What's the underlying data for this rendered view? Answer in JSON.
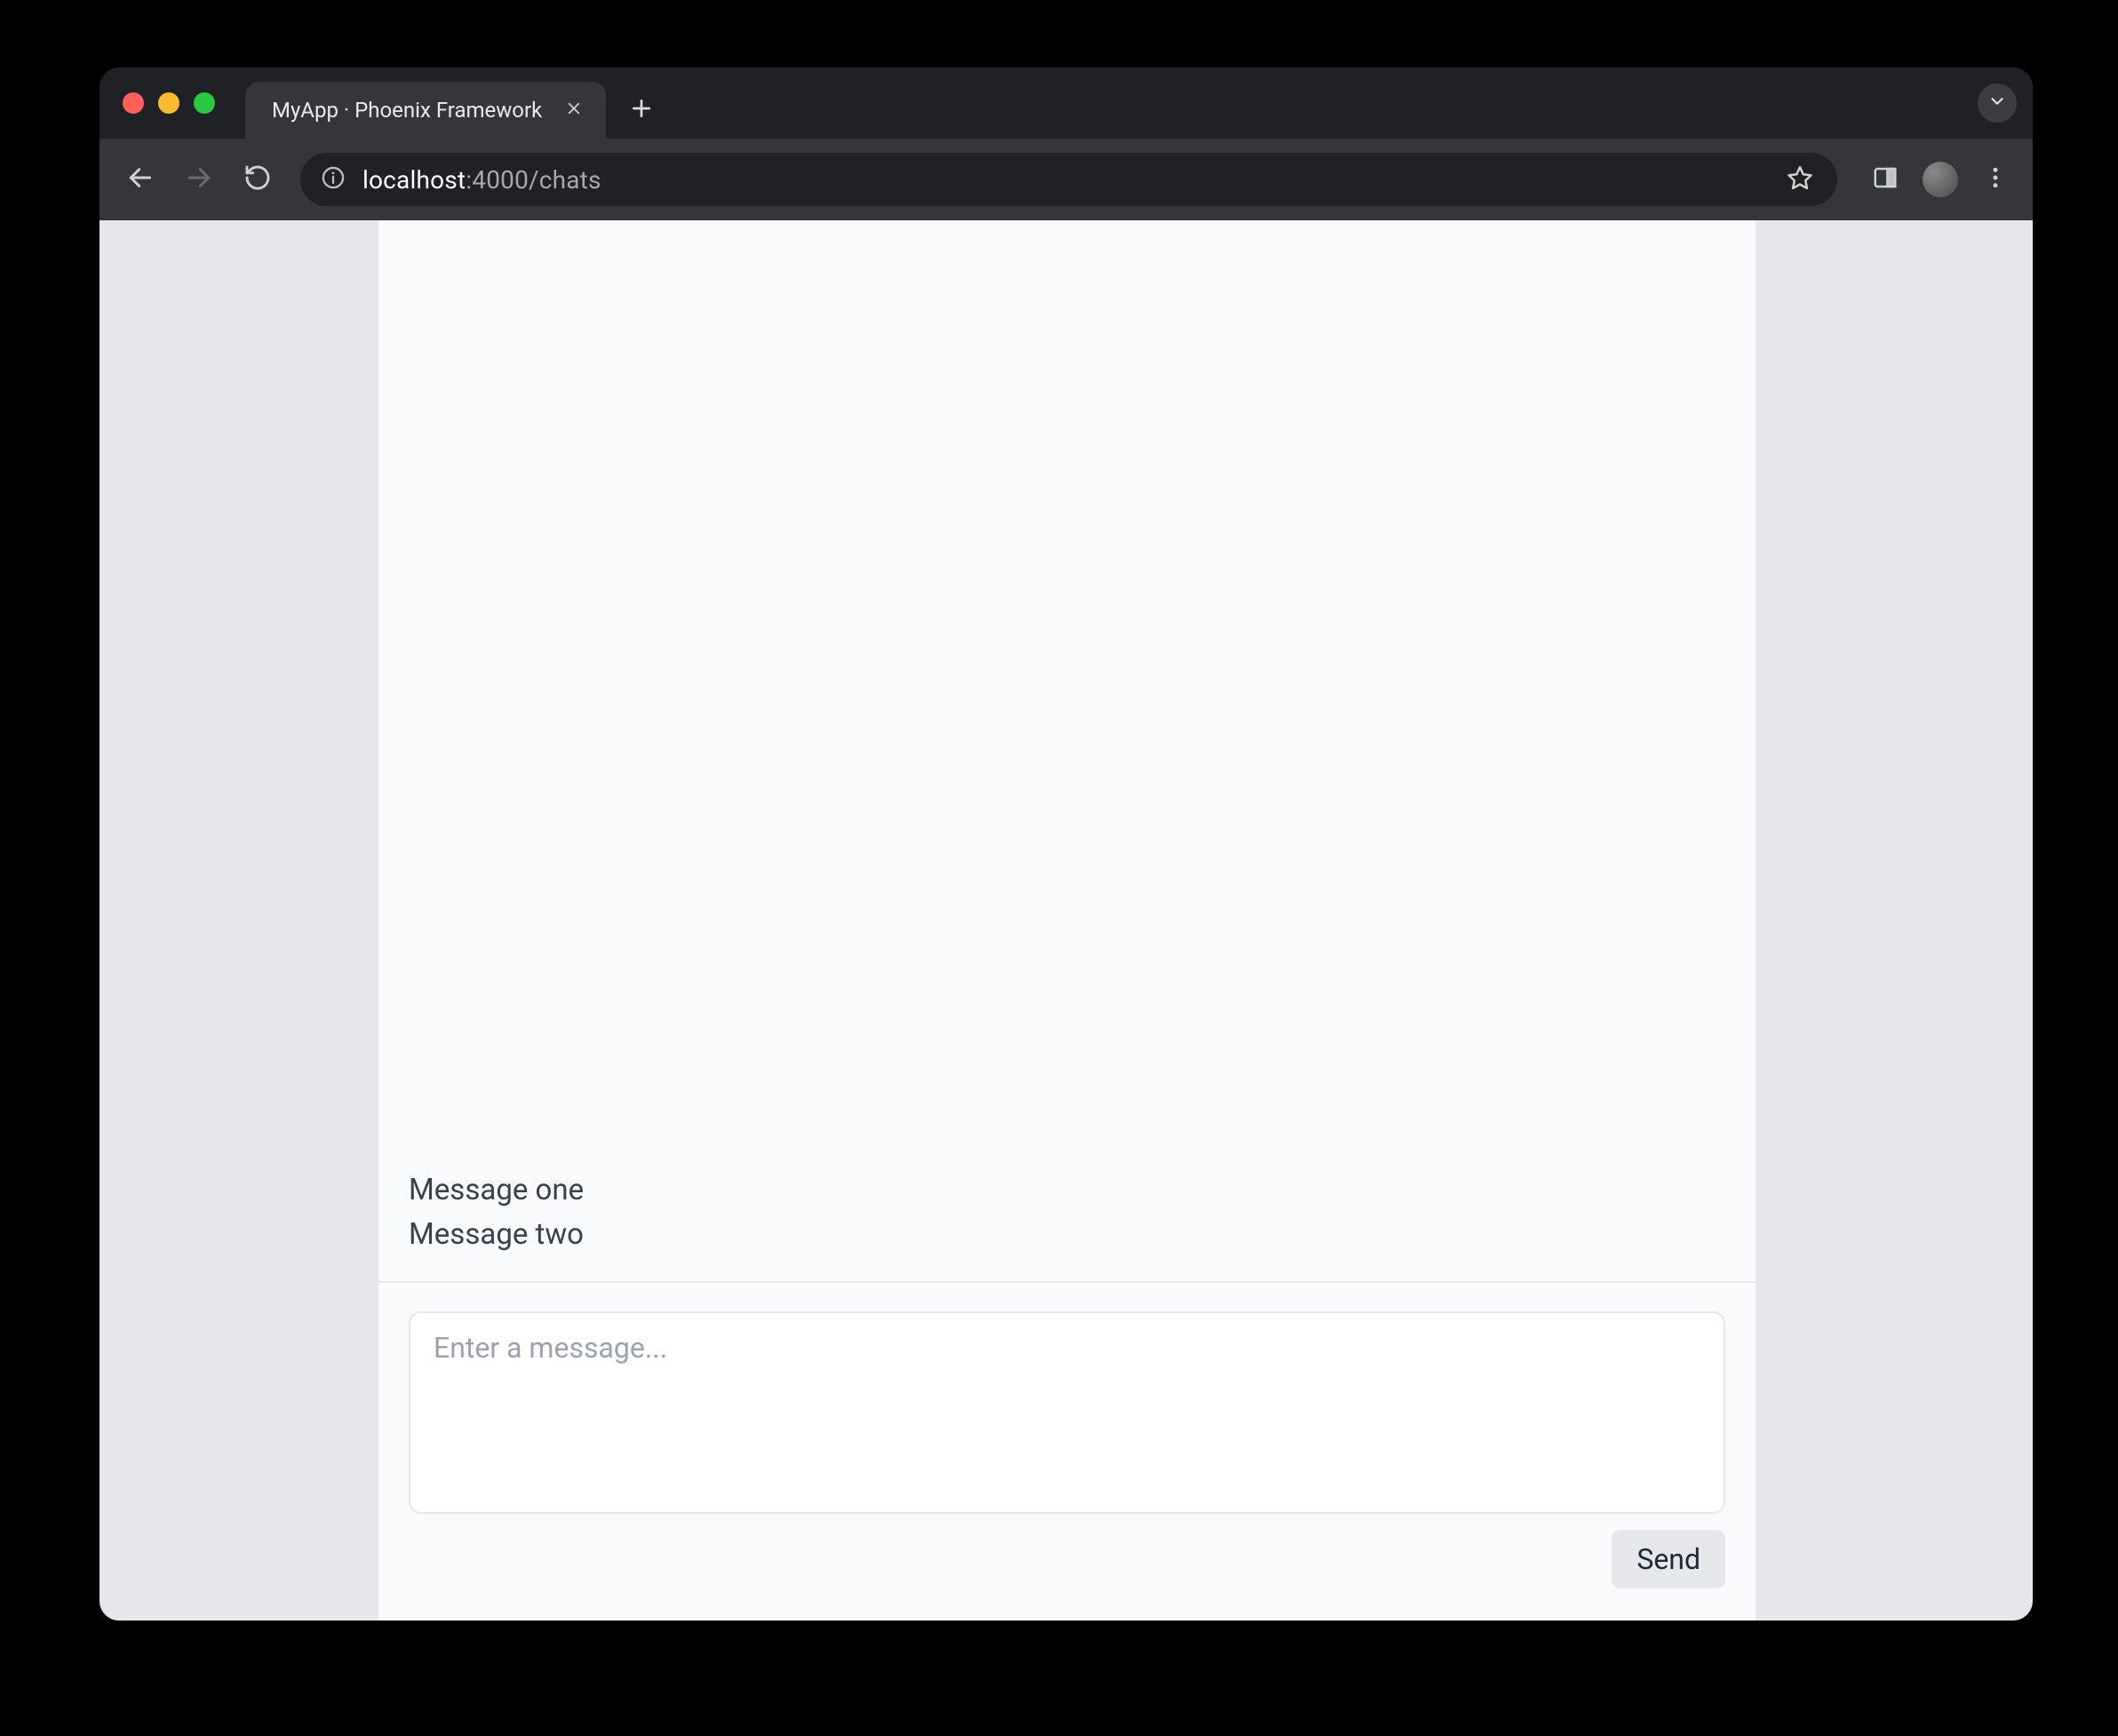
{
  "browser": {
    "tab_title": "MyApp · Phoenix Framework",
    "url_host": "localhost",
    "url_rest": ":4000/chats"
  },
  "chat": {
    "messages": [
      "Message one",
      "Message two"
    ],
    "input_placeholder": "Enter a message...",
    "send_label": "Send"
  }
}
